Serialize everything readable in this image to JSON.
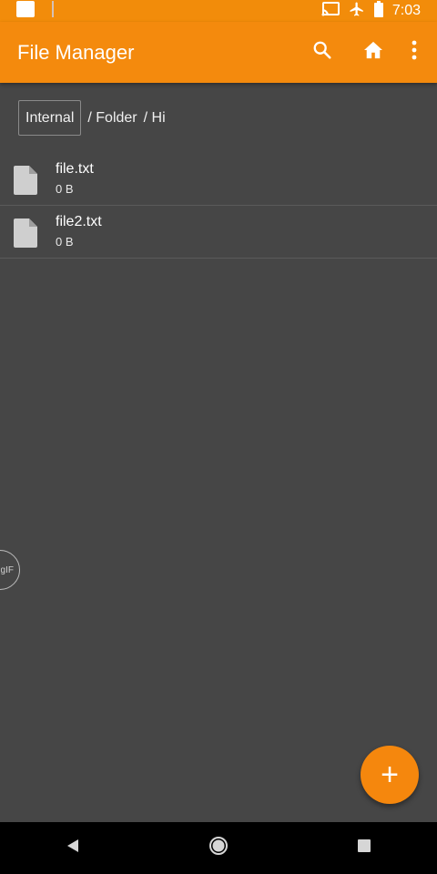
{
  "status_bar": {
    "time": "7:03",
    "icons": [
      "notification-square-icon",
      "usb-debug-icon",
      "cast-icon",
      "airplane-mode-icon",
      "battery-icon"
    ]
  },
  "app_bar": {
    "title": "File Manager",
    "actions": [
      "search-icon",
      "home-icon",
      "more-vert-icon"
    ]
  },
  "breadcrumb": {
    "root": "Internal",
    "segments": [
      "/ Folder",
      "/ Hi"
    ]
  },
  "files": [
    {
      "name": "file.txt",
      "size": "0 B",
      "icon": "file-icon"
    },
    {
      "name": "file2.txt",
      "size": "0 B",
      "icon": "file-icon"
    }
  ],
  "gif_badge": "gIF",
  "fab": {
    "label": "+",
    "icon": "add-icon"
  },
  "colors": {
    "accent": "#f48a0d",
    "background": "#464646",
    "nav_bar": "#000000"
  }
}
